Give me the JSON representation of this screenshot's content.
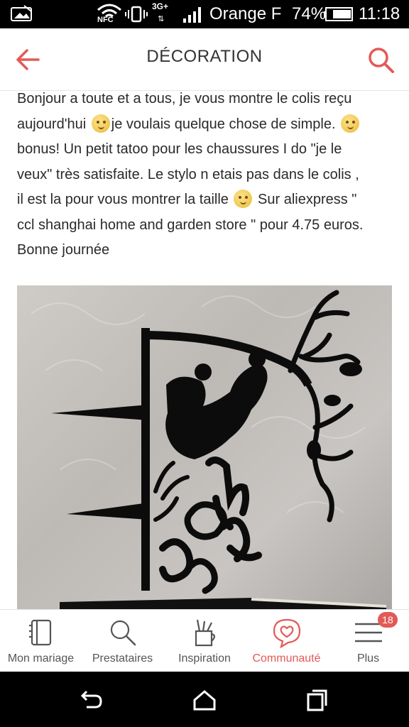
{
  "status_bar": {
    "nfc_label": "NFC",
    "network_type": "3G+",
    "carrier": "Orange F",
    "battery_percent": "74%",
    "time": "11:18"
  },
  "header": {
    "title": "DÉCORATION",
    "back_icon": "arrow-left-icon",
    "search_icon": "search-icon",
    "accent_color": "#e25a57"
  },
  "post": {
    "lines": [
      "Bonjour a toute et a tous, je vous montre le colis reçu",
      "aujourd'hui ",
      "je voulais quelque chose de simple. ",
      "bonus! Un petit tatoo pour les chaussures I do \"je le",
      "veux\" très satisfaite. Le stylo n etais pas dans le colis ,",
      "il est la pour vous montrer la taille ",
      " Sur aliexpress \"",
      "ccl shanghai home and garden store \" pour 4.75 euros.",
      "Bonne journée"
    ],
    "emoji_name": "smirk-emoji",
    "image_name": "cake-topper-photo"
  },
  "bottom_nav": {
    "items": [
      {
        "label": "Mon mariage",
        "icon": "notebook-icon"
      },
      {
        "label": "Prestataires",
        "icon": "search-icon"
      },
      {
        "label": "Inspiration",
        "icon": "pencil-cup-icon"
      },
      {
        "label": "Communauté",
        "icon": "heart-chat-icon",
        "active": true
      },
      {
        "label": "Plus",
        "icon": "menu-icon"
      }
    ],
    "badge_count": "18"
  },
  "system_nav": {
    "back_icon": "back-icon",
    "home_icon": "home-icon",
    "recents_icon": "recents-icon"
  }
}
